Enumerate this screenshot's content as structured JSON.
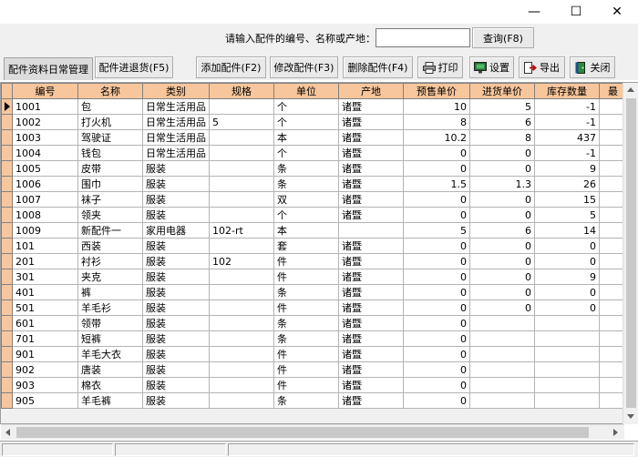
{
  "window": {
    "minimize_glyph": "—",
    "maximize_glyph": "☐",
    "close_glyph": "✕"
  },
  "search": {
    "label": "请输入配件的编号、名称或产地：",
    "value": "",
    "button_label": "查询(F8)"
  },
  "toolbar": {
    "active_tab": "配件资料日常管理",
    "buttons": {
      "stock_in_out": "配件进退货(F5)",
      "add": "添加配件(F2)",
      "edit": "修改配件(F3)",
      "delete": "删除配件(F4)",
      "print": "打印",
      "settings": "设置",
      "export": "导出",
      "close": "关闭"
    },
    "icons": {
      "print": "printer-icon",
      "settings": "monitor-icon",
      "export": "export-icon",
      "close": "exit-door-icon"
    }
  },
  "grid": {
    "columns": [
      "编号",
      "名称",
      "类别",
      "规格",
      "单位",
      "产地",
      "预售单价",
      "进货单价",
      "库存数量",
      "最"
    ],
    "rows": [
      [
        "1001",
        "包",
        "日常生活用品",
        "",
        "个",
        "诸暨",
        "10",
        "5",
        "-1"
      ],
      [
        "1002",
        "打火机",
        "日常生活用品",
        "5",
        "个",
        "诸暨",
        "8",
        "6",
        "-1"
      ],
      [
        "1003",
        "驾驶证",
        "日常生活用品",
        "",
        "本",
        "诸暨",
        "10.2",
        "8",
        "437"
      ],
      [
        "1004",
        "钱包",
        "日常生活用品",
        "",
        "个",
        "诸暨",
        "0",
        "0",
        "-1"
      ],
      [
        "1005",
        "皮带",
        "服装",
        "",
        "条",
        "诸暨",
        "0",
        "0",
        "9"
      ],
      [
        "1006",
        "围巾",
        "服装",
        "",
        "条",
        "诸暨",
        "1.5",
        "1.3",
        "26"
      ],
      [
        "1007",
        "袜子",
        "服装",
        "",
        "双",
        "诸暨",
        "0",
        "0",
        "15"
      ],
      [
        "1008",
        "领夹",
        "服装",
        "",
        "个",
        "诸暨",
        "0",
        "0",
        "5"
      ],
      [
        "1009",
        "新配件一",
        "家用电器",
        "102-rt",
        "本",
        "",
        "5",
        "6",
        "14"
      ],
      [
        "101",
        "西装",
        "服装",
        "",
        "套",
        "诸暨",
        "0",
        "0",
        "0"
      ],
      [
        "201",
        "衬衫",
        "服装",
        "102",
        "件",
        "诸暨",
        "0",
        "0",
        "0"
      ],
      [
        "301",
        "夹克",
        "服装",
        "",
        "件",
        "诸暨",
        "0",
        "0",
        "9"
      ],
      [
        "401",
        "裤",
        "服装",
        "",
        "条",
        "诸暨",
        "0",
        "0",
        "0"
      ],
      [
        "501",
        "羊毛衫",
        "服装",
        "",
        "件",
        "诸暨",
        "0",
        "0",
        "0"
      ],
      [
        "601",
        "领带",
        "服装",
        "",
        "条",
        "诸暨",
        "0",
        "",
        ""
      ],
      [
        "701",
        "短裤",
        "服装",
        "",
        "条",
        "诸暨",
        "0",
        "",
        ""
      ],
      [
        "901",
        "羊毛大衣",
        "服装",
        "",
        "件",
        "诸暨",
        "0",
        "",
        ""
      ],
      [
        "902",
        "唐装",
        "服装",
        "",
        "件",
        "诸暨",
        "0",
        "",
        ""
      ],
      [
        "903",
        "棉衣",
        "服装",
        "",
        "件",
        "诸暨",
        "0",
        "",
        ""
      ],
      [
        "905",
        "羊毛裤",
        "服装",
        "",
        "条",
        "诸暨",
        "0",
        "",
        ""
      ]
    ],
    "current_row": 0
  },
  "colors": {
    "header_bg": "#f8c69c",
    "chrome_bg": "#f0f0f0"
  }
}
